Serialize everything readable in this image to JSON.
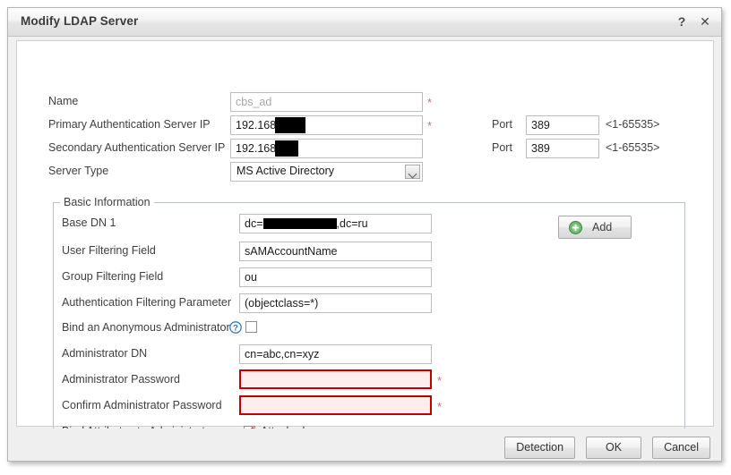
{
  "window": {
    "title": "Modify LDAP Server",
    "help_icon": "question-mark-icon",
    "close_icon": "close-icon"
  },
  "top_section": {
    "name": {
      "label": "Name",
      "value": "cbs_ad",
      "required_marker": "*",
      "disabled": true
    },
    "primary_ip": {
      "label": "Primary Authentication Server IP",
      "value": "192.168",
      "redacted": true,
      "required_marker": "*"
    },
    "primary_port": {
      "label": "Port",
      "value": "389",
      "hint": "<1-65535>"
    },
    "secondary_ip": {
      "label": "Secondary Authentication Server IP",
      "value": "192.168",
      "redacted": true
    },
    "secondary_port": {
      "label": "Port",
      "value": "389",
      "hint": "<1-65535>"
    },
    "server_type": {
      "label": "Server Type",
      "value": "MS Active Directory",
      "options": [
        "MS Active Directory"
      ]
    }
  },
  "basic_information": {
    "legend": "Basic Information",
    "add_button": {
      "label": "Add",
      "icon": "add-circle-icon"
    },
    "base_dn_1": {
      "label": "Base DN 1",
      "value_prefix": "dc=",
      "value_suffix": ",dc=ru",
      "redacted": true
    },
    "user_filtering_field": {
      "label": "User Filtering Field",
      "value": "sAMAccountName"
    },
    "group_filtering_field": {
      "label": "Group Filtering Field",
      "value": "ou"
    },
    "auth_filtering_parameter": {
      "label": "Authentication Filtering Parameter",
      "value": "(objectclass=*)"
    },
    "bind_anonymous_admin": {
      "label": "Bind an Anonymous Administrator",
      "help_icon": "help-circle-icon",
      "checked": false
    },
    "administrator_dn": {
      "label": "Administrator DN",
      "value": "cn=abc,cn=xyz"
    },
    "administrator_password": {
      "label": "Administrator Password",
      "value": "",
      "required_marker": "*",
      "error": true
    },
    "confirm_administrator_password": {
      "label": "Confirm Administrator Password",
      "value": "",
      "required_marker": "*",
      "error": true
    },
    "bind_attributes": {
      "label": "Bind Attributes to Administrator",
      "checkbox_label": "Attached Base DN",
      "checked": true,
      "check_glyph": "✔"
    }
  },
  "footer": {
    "detection_label": "Detection",
    "ok_label": "OK",
    "cancel_label": "Cancel"
  },
  "colors": {
    "error_border": "#c20000",
    "error_fill": "#fdeded",
    "required_star": "#f06060",
    "accent_green": "#5eb85e",
    "accent_blue": "#3a7bbf",
    "check_red": "#c62828"
  }
}
